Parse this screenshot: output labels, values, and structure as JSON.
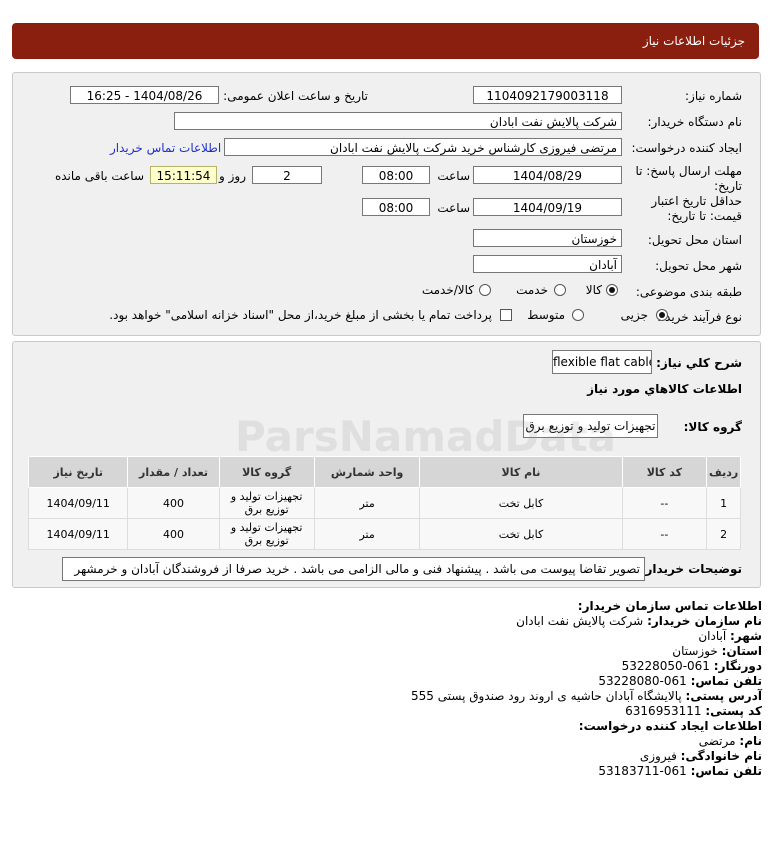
{
  "header": {
    "title": "جزئیات اطلاعات نیاز"
  },
  "form": {
    "need_no_label": "شماره نیاز:",
    "need_no": "1104092179003118",
    "announce_label": "تاریخ و ساعت اعلان عمومی:",
    "announce": "1404/08/26 - 16:25",
    "buyer_label": "نام دستگاه خریدار:",
    "buyer": "شرکت پالایش نفت ابادان",
    "creator_label": "ایجاد کننده درخواست:",
    "creator": "مرتضی فیروزی کارشناس خرید  شرکت پالایش نفت ابادان",
    "contact_link": "اطلاعات تماس خریدار",
    "deadline_label_1": "مهلت ارسال پاسخ: تا",
    "deadline_label_2": "تاریخ:",
    "deadline_date": "1404/08/29",
    "time_label": "ساعت",
    "deadline_time": "08:00",
    "days": "2",
    "days_label": "روز و",
    "remaining": "15:11:54",
    "remaining_label": "ساعت باقی مانده",
    "validity_label_1": "حداقل تاریخ اعتبار",
    "validity_label_2": "قیمت: تا تاریخ:",
    "validity_date": "1404/09/19",
    "validity_time": "08:00",
    "province_label": "استان محل تحویل:",
    "province": "خوزستان",
    "city_label": "شهر محل تحویل:",
    "city": "آبادان",
    "category_label": "طبقه بندی موضوعی:",
    "category_options": [
      "کالا",
      "خدمت",
      "کالا/خدمت"
    ],
    "process_label": "نوع فرآیند خرید :",
    "process_options": [
      "جزیی",
      "متوسط"
    ],
    "payment_note": "پرداخت تمام یا بخشی از مبلغ خرید،از محل \"اسناد خزانه اسلامی\" خواهد بود."
  },
  "details": {
    "desc_label": "شرح کلي نياز:",
    "desc": "flexible flat cable",
    "goods_info_label": "اطلاعات کالاهاي مورد نياز",
    "group_label": "گروه کالا:",
    "group": "تجهیزات تولید و توزیع برق",
    "columns": [
      "ردیف",
      "کد کالا",
      "نام کالا",
      "واحد شمارش",
      "گروه کالا",
      "تعداد / مقدار",
      "تاریخ نیاز"
    ],
    "rows": [
      {
        "idx": "1",
        "code": "--",
        "name": "کابل تخت",
        "unit": "متر",
        "group": "تجهیزات تولید و توزیع برق",
        "qty": "400",
        "date": "1404/09/11"
      },
      {
        "idx": "2",
        "code": "--",
        "name": "کابل تخت",
        "unit": "متر",
        "group": "تجهیزات تولید و توزیع برق",
        "qty": "400",
        "date": "1404/09/11"
      }
    ],
    "notes_label": "توضیحات خریدار:",
    "notes": "تصویر تقاضا پیوست می باشد . پیشنهاد فنی و مالی الزامی می باشد . خرید صرفا از فروشندگان آبادان و خرمشهر"
  },
  "contact": {
    "title": "اطلاعات تماس سازمان خریدار:",
    "org_label": "نام سازمان خریدار:",
    "org": "شرکت پالایش نفت ابادان",
    "city_label": "شهر:",
    "city": "آبادان",
    "province_label": "استان:",
    "province": "خوزستان",
    "fax_label": "دورنگار:",
    "fax": "061-53228050",
    "phone_label": "تلفن تماس:",
    "phone": "061-53228080",
    "address_label": "آدرس پستی:",
    "address": "پالایشگاه آبادان حاشیه ی اروند رود صندوق پستی 555",
    "postal_label": "کد پستی:",
    "postal": "6316953111",
    "creator_title": "اطلاعات ایجاد کننده درخواست:",
    "name_label": "نام:",
    "name": "مرتضی",
    "family_label": "نام خانوادگی:",
    "family": "فیروزی",
    "creator_phone_label": "تلفن تماس:",
    "creator_phone": "061-53183711"
  },
  "watermark": {
    "brand": "ParsNamadData"
  }
}
